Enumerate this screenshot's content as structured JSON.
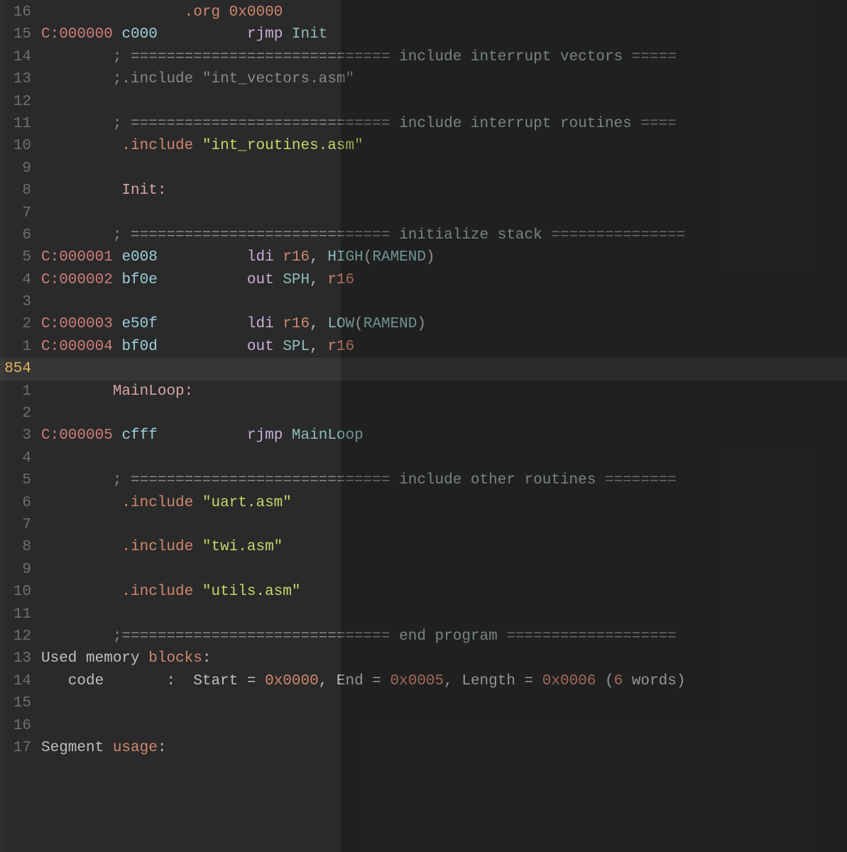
{
  "editor": {
    "current_line_absolute": 854,
    "lines": [
      {
        "rel": "16",
        "tokens": [
          {
            "cls": "plain",
            "t": "                "
          },
          {
            "cls": "dir",
            "t": ".org"
          },
          {
            "cls": "plain",
            "t": " "
          },
          {
            "cls": "num",
            "t": "0x0000"
          }
        ]
      },
      {
        "rel": "15",
        "tokens": [
          {
            "cls": "addr",
            "t": "C:000000"
          },
          {
            "cls": "plain",
            "t": " "
          },
          {
            "cls": "hex",
            "t": "c000"
          },
          {
            "cls": "plain",
            "t": "          "
          },
          {
            "cls": "mnem",
            "t": "rjmp"
          },
          {
            "cls": "plain",
            "t": " "
          },
          {
            "cls": "ident",
            "t": "Init"
          }
        ]
      },
      {
        "rel": "14",
        "tokens": [
          {
            "cls": "plain",
            "t": "        "
          },
          {
            "cls": "cmt",
            "t": "; ============================="
          },
          {
            "cls": "plain",
            "t": " "
          },
          {
            "cls": "cmttxt",
            "t": "include interrupt vectors"
          },
          {
            "cls": "plain",
            "t": " "
          },
          {
            "cls": "cmt",
            "t": "====="
          }
        ]
      },
      {
        "rel": "13",
        "tokens": [
          {
            "cls": "plain",
            "t": "        "
          },
          {
            "cls": "cmt",
            "t": ";.include "
          },
          {
            "cls": "cmt",
            "t": "\"int_vectors.asm\""
          }
        ]
      },
      {
        "rel": "12",
        "tokens": []
      },
      {
        "rel": "11",
        "tokens": [
          {
            "cls": "plain",
            "t": "        "
          },
          {
            "cls": "cmt",
            "t": "; ============================="
          },
          {
            "cls": "plain",
            "t": " "
          },
          {
            "cls": "cmttxt",
            "t": "include interrupt routines"
          },
          {
            "cls": "plain",
            "t": " "
          },
          {
            "cls": "cmt",
            "t": "===="
          }
        ]
      },
      {
        "rel": "10",
        "tokens": [
          {
            "cls": "plain",
            "t": "         "
          },
          {
            "cls": "dir",
            "t": ".include"
          },
          {
            "cls": "plain",
            "t": " "
          },
          {
            "cls": "str",
            "t": "\"int_routines.asm\""
          }
        ]
      },
      {
        "rel": "9",
        "tokens": []
      },
      {
        "rel": "8",
        "tokens": [
          {
            "cls": "plain",
            "t": "         "
          },
          {
            "cls": "label",
            "t": "Init:"
          }
        ]
      },
      {
        "rel": "7",
        "tokens": []
      },
      {
        "rel": "6",
        "tokens": [
          {
            "cls": "plain",
            "t": "        "
          },
          {
            "cls": "cmt",
            "t": "; ============================="
          },
          {
            "cls": "plain",
            "t": " "
          },
          {
            "cls": "cmttxt",
            "t": "initialize stack"
          },
          {
            "cls": "plain",
            "t": " "
          },
          {
            "cls": "cmt",
            "t": "==============="
          }
        ]
      },
      {
        "rel": "5",
        "tokens": [
          {
            "cls": "addr",
            "t": "C:000001"
          },
          {
            "cls": "plain",
            "t": " "
          },
          {
            "cls": "hex",
            "t": "e008"
          },
          {
            "cls": "plain",
            "t": "          "
          },
          {
            "cls": "mnem",
            "t": "ldi"
          },
          {
            "cls": "plain",
            "t": " "
          },
          {
            "cls": "num",
            "t": "r16"
          },
          {
            "cls": "punct",
            "t": ", "
          },
          {
            "cls": "ident",
            "t": "HIGH"
          },
          {
            "cls": "punct",
            "t": "("
          },
          {
            "cls": "ident",
            "t": "RAMEND"
          },
          {
            "cls": "punct",
            "t": ")"
          }
        ]
      },
      {
        "rel": "4",
        "tokens": [
          {
            "cls": "addr",
            "t": "C:000002"
          },
          {
            "cls": "plain",
            "t": " "
          },
          {
            "cls": "hex",
            "t": "bf0e"
          },
          {
            "cls": "plain",
            "t": "          "
          },
          {
            "cls": "mnem",
            "t": "out"
          },
          {
            "cls": "plain",
            "t": " "
          },
          {
            "cls": "ident",
            "t": "SPH"
          },
          {
            "cls": "punct",
            "t": ", "
          },
          {
            "cls": "num",
            "t": "r16"
          }
        ]
      },
      {
        "rel": "3",
        "tokens": []
      },
      {
        "rel": "2",
        "tokens": [
          {
            "cls": "addr",
            "t": "C:000003"
          },
          {
            "cls": "plain",
            "t": " "
          },
          {
            "cls": "hex",
            "t": "e50f"
          },
          {
            "cls": "plain",
            "t": "          "
          },
          {
            "cls": "mnem",
            "t": "ldi"
          },
          {
            "cls": "plain",
            "t": " "
          },
          {
            "cls": "num",
            "t": "r16"
          },
          {
            "cls": "punct",
            "t": ", "
          },
          {
            "cls": "ident",
            "t": "LOW"
          },
          {
            "cls": "punct",
            "t": "("
          },
          {
            "cls": "ident",
            "t": "RAMEND"
          },
          {
            "cls": "punct",
            "t": ")"
          }
        ]
      },
      {
        "rel": "1",
        "tokens": [
          {
            "cls": "addr",
            "t": "C:000004"
          },
          {
            "cls": "plain",
            "t": " "
          },
          {
            "cls": "hex",
            "t": "bf0d"
          },
          {
            "cls": "plain",
            "t": "          "
          },
          {
            "cls": "mnem",
            "t": "out"
          },
          {
            "cls": "plain",
            "t": " "
          },
          {
            "cls": "ident",
            "t": "SPL"
          },
          {
            "cls": "punct",
            "t": ", "
          },
          {
            "cls": "num",
            "t": "r16"
          }
        ]
      },
      {
        "rel": "854",
        "abs": true,
        "current": true,
        "tokens": []
      },
      {
        "rel": "1",
        "tokens": [
          {
            "cls": "plain",
            "t": "        "
          },
          {
            "cls": "label",
            "t": "MainLoop:"
          }
        ]
      },
      {
        "rel": "2",
        "tokens": []
      },
      {
        "rel": "3",
        "tokens": [
          {
            "cls": "addr",
            "t": "C:000005"
          },
          {
            "cls": "plain",
            "t": " "
          },
          {
            "cls": "hex",
            "t": "cfff"
          },
          {
            "cls": "plain",
            "t": "          "
          },
          {
            "cls": "mnem",
            "t": "rjmp"
          },
          {
            "cls": "plain",
            "t": " "
          },
          {
            "cls": "ident",
            "t": "MainLoop"
          }
        ]
      },
      {
        "rel": "4",
        "tokens": []
      },
      {
        "rel": "5",
        "tokens": [
          {
            "cls": "plain",
            "t": "        "
          },
          {
            "cls": "cmt",
            "t": "; ============================="
          },
          {
            "cls": "plain",
            "t": " "
          },
          {
            "cls": "cmttxt",
            "t": "include other routines"
          },
          {
            "cls": "plain",
            "t": " "
          },
          {
            "cls": "cmt",
            "t": "========"
          }
        ]
      },
      {
        "rel": "6",
        "tokens": [
          {
            "cls": "plain",
            "t": "         "
          },
          {
            "cls": "dir",
            "t": ".include"
          },
          {
            "cls": "plain",
            "t": " "
          },
          {
            "cls": "str",
            "t": "\"uart.asm\""
          }
        ]
      },
      {
        "rel": "7",
        "tokens": []
      },
      {
        "rel": "8",
        "tokens": [
          {
            "cls": "plain",
            "t": "         "
          },
          {
            "cls": "dir",
            "t": ".include"
          },
          {
            "cls": "plain",
            "t": " "
          },
          {
            "cls": "str",
            "t": "\"twi.asm\""
          }
        ]
      },
      {
        "rel": "9",
        "tokens": []
      },
      {
        "rel": "10",
        "tokens": [
          {
            "cls": "plain",
            "t": "         "
          },
          {
            "cls": "dir",
            "t": ".include"
          },
          {
            "cls": "plain",
            "t": " "
          },
          {
            "cls": "str",
            "t": "\"utils.asm\""
          }
        ]
      },
      {
        "rel": "11",
        "tokens": []
      },
      {
        "rel": "12",
        "tokens": [
          {
            "cls": "plain",
            "t": "        "
          },
          {
            "cls": "cmt",
            "t": ";=============================="
          },
          {
            "cls": "plain",
            "t": " "
          },
          {
            "cls": "cmttxt",
            "t": "end program"
          },
          {
            "cls": "plain",
            "t": " "
          },
          {
            "cls": "cmt",
            "t": "==================="
          }
        ]
      },
      {
        "rel": "13",
        "tokens": [
          {
            "cls": "plain",
            "t": "Used memory "
          },
          {
            "cls": "kw",
            "t": "blocks"
          },
          {
            "cls": "plain",
            "t": ":"
          }
        ]
      },
      {
        "rel": "14",
        "tokens": [
          {
            "cls": "plain",
            "t": "   code       :  Start = "
          },
          {
            "cls": "num",
            "t": "0x0000"
          },
          {
            "cls": "plain",
            "t": ", End = "
          },
          {
            "cls": "num",
            "t": "0x0005"
          },
          {
            "cls": "plain",
            "t": ", Length = "
          },
          {
            "cls": "num",
            "t": "0x0006"
          },
          {
            "cls": "plain",
            "t": " ("
          },
          {
            "cls": "num",
            "t": "6"
          },
          {
            "cls": "plain",
            "t": " words)"
          }
        ]
      },
      {
        "rel": "15",
        "tokens": []
      },
      {
        "rel": "16",
        "tokens": []
      },
      {
        "rel": "17",
        "tokens": [
          {
            "cls": "plain",
            "t": "Segment "
          },
          {
            "cls": "kw",
            "t": "usage"
          },
          {
            "cls": "plain",
            "t": ":"
          }
        ]
      }
    ]
  }
}
